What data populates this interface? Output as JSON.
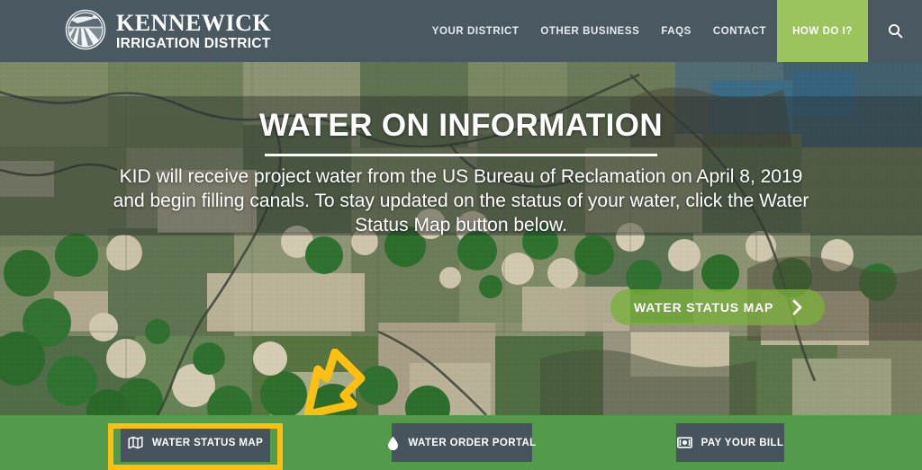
{
  "brand": {
    "logo_icon": "irrigation-field-circle-logo",
    "line1": "KENNEWICK",
    "line2": "IRRIGATION DISTRICT"
  },
  "nav": {
    "items": [
      {
        "label": "YOUR DISTRICT",
        "highlighted": false
      },
      {
        "label": "OTHER BUSINESS",
        "highlighted": false
      },
      {
        "label": "FAQS",
        "highlighted": false
      },
      {
        "label": "CONTACT",
        "highlighted": false
      },
      {
        "label": "HOW DO I?",
        "highlighted": true
      }
    ],
    "search_icon": "search-icon"
  },
  "hero": {
    "title": "WATER ON INFORMATION",
    "subtitle": "KID will receive project water from the US Bureau of Reclamation on April 8, 2019 and begin filling canals. To stay updated on the status of your water, click the Water Status Map button below.",
    "cta_label": "WATER STATUS MAP",
    "cta_icon": "chevron-right-icon",
    "background": "aerial-farmland-satellite-photo"
  },
  "annotation": {
    "arrow_icon": "arrow-down-left-icon",
    "arrow_color": "#fdc011",
    "highlight_color": "#fdc011",
    "highlight_target": "water-status-map-button"
  },
  "action_bar": {
    "buttons": [
      {
        "label": "WATER STATUS MAP",
        "icon": "map-icon"
      },
      {
        "label": "WATER ORDER PORTAL",
        "icon": "water-drop-icon"
      },
      {
        "label": "PAY YOUR BILL",
        "icon": "money-bill-icon"
      }
    ]
  },
  "colors": {
    "header_bg": "#4a5862",
    "nav_highlight": "#9bc45e",
    "green_bar": "#539a4a",
    "button_bg": "#47545e",
    "accent_yellow": "#fdc011"
  }
}
